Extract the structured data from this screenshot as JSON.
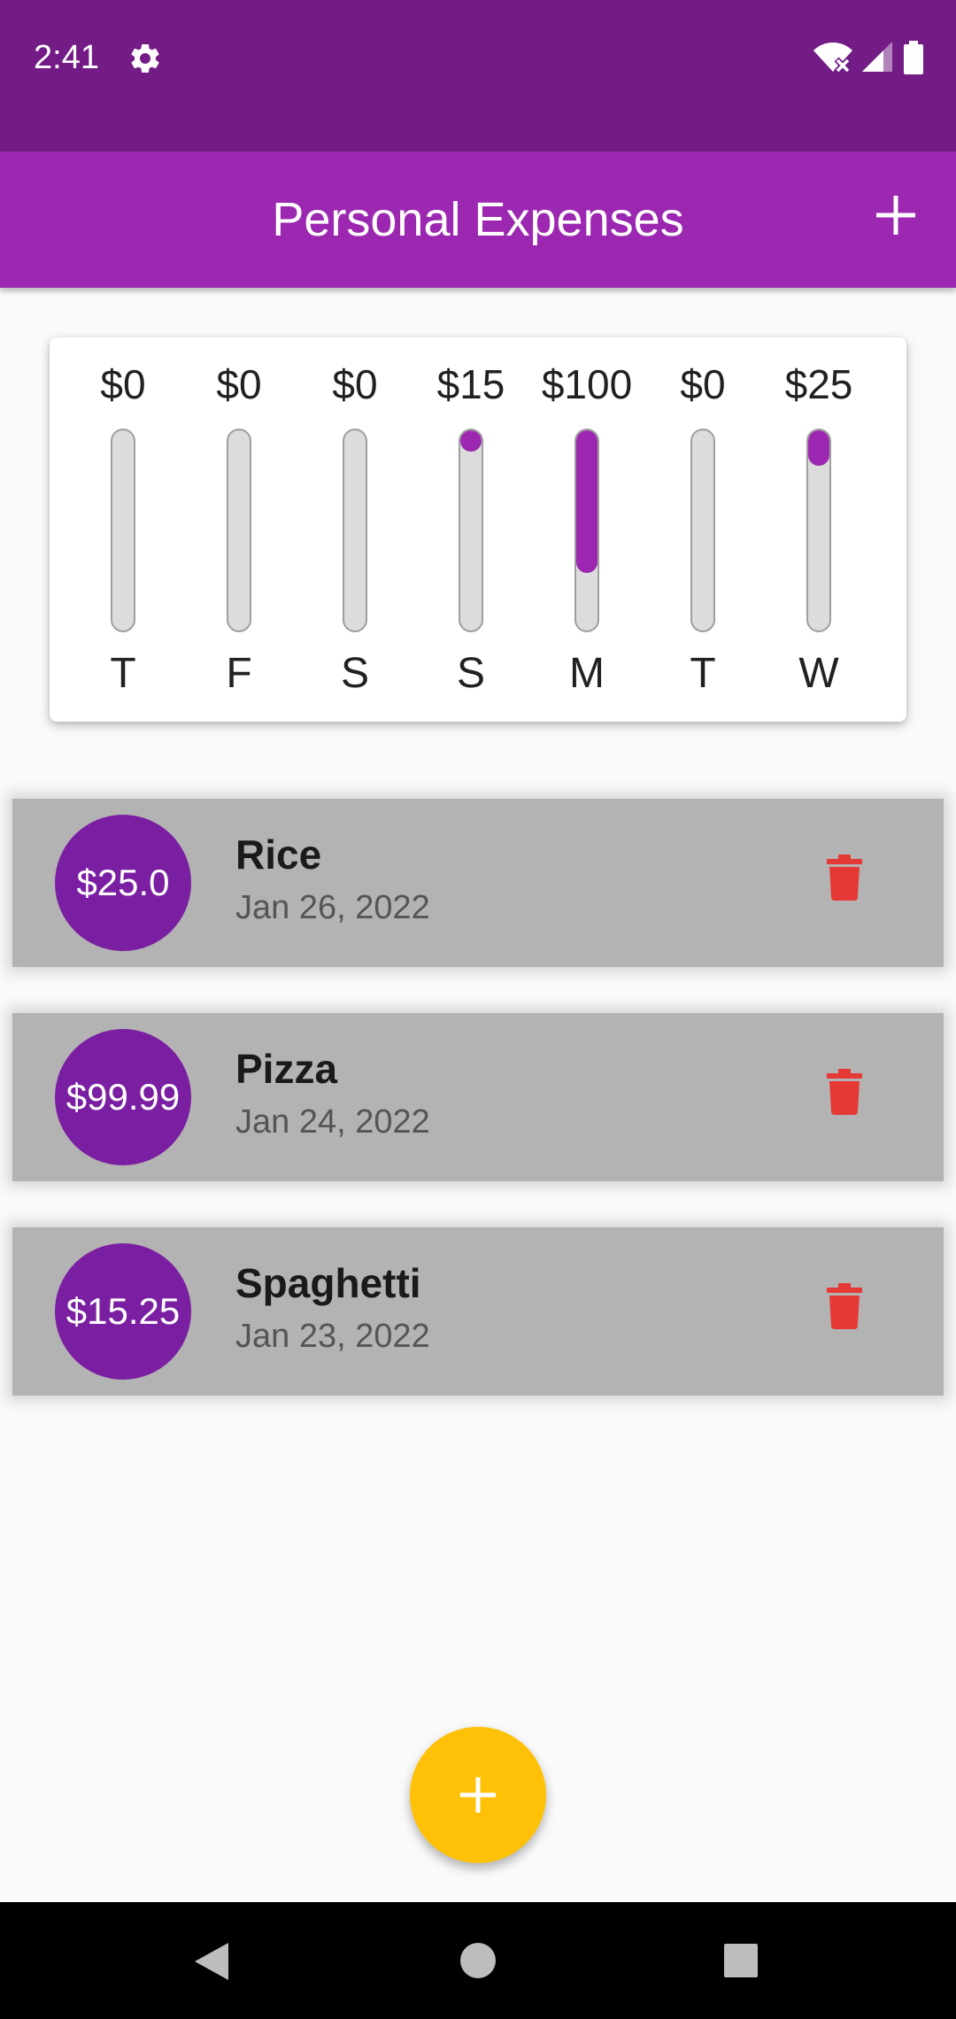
{
  "status_bar": {
    "time": "2:41"
  },
  "app_bar": {
    "title": "Personal Expenses"
  },
  "chart_data": {
    "type": "bar",
    "categories": [
      "T",
      "F",
      "S",
      "S",
      "M",
      "T",
      "W"
    ],
    "values": [
      0,
      0,
      0,
      15,
      100,
      0,
      25
    ],
    "value_labels": [
      "$0",
      "$0",
      "$0",
      "$15",
      "$100",
      "$0",
      "$25"
    ],
    "fill_fraction": [
      0,
      0,
      0,
      0.107,
      0.714,
      0,
      0.179
    ],
    "bar_color": "#9c27b0"
  },
  "transactions": [
    {
      "amount": "$25.0",
      "title": "Rice",
      "date": "Jan 26, 2022"
    },
    {
      "amount": "$99.99",
      "title": "Pizza",
      "date": "Jan 24, 2022"
    },
    {
      "amount": "$15.25",
      "title": "Spaghetti",
      "date": "Jan 23, 2022"
    }
  ],
  "colors": {
    "primary": "#9c27b0",
    "primary_dark": "#731c85",
    "accent": "#ffc107",
    "delete": "#e53935"
  }
}
